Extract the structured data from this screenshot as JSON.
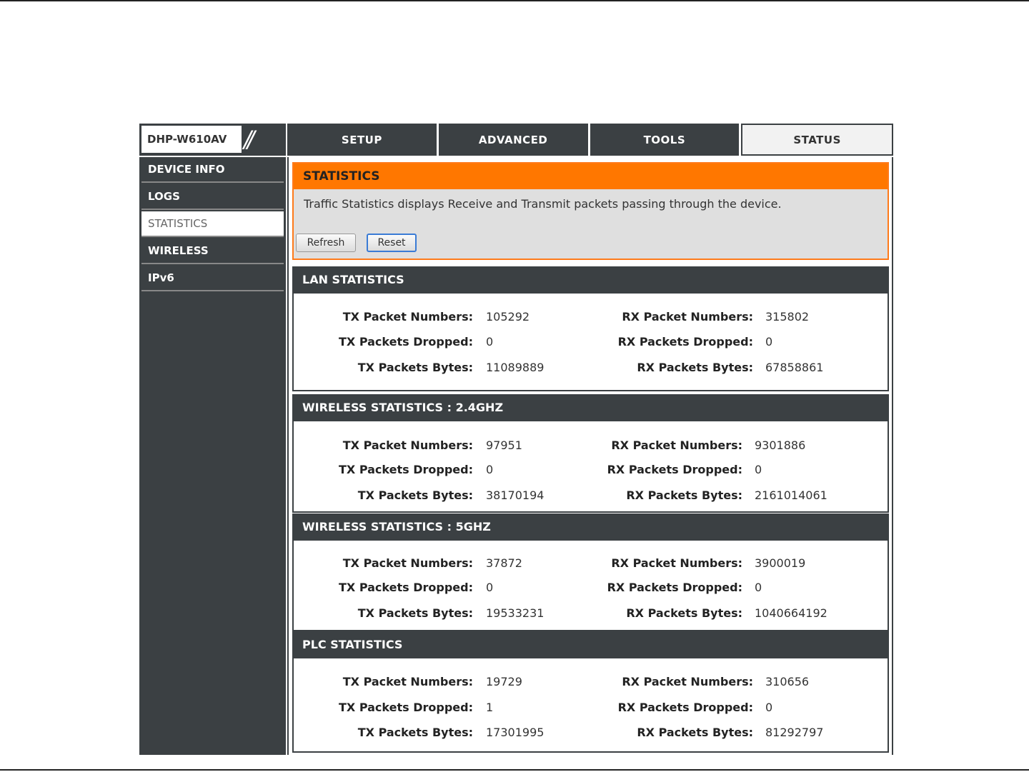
{
  "header": {
    "model": "DHP-W610AV",
    "tabs": [
      {
        "label": "SETUP"
      },
      {
        "label": "ADVANCED"
      },
      {
        "label": "TOOLS"
      },
      {
        "label": "STATUS"
      }
    ]
  },
  "sidebar": {
    "items": [
      {
        "label": "DEVICE INFO"
      },
      {
        "label": "LOGS"
      },
      {
        "label": "STATISTICS"
      },
      {
        "label": "WIRELESS"
      },
      {
        "label": "IPv6"
      }
    ]
  },
  "statistics": {
    "title": "STATISTICS",
    "description": "Traffic Statistics displays Receive and Transmit packets passing through the device.",
    "refresh_label": "Refresh",
    "reset_label": "Reset"
  },
  "labels": {
    "tx_numbers": "TX Packet Numbers:",
    "tx_dropped": "TX Packets Dropped:",
    "tx_bytes": "TX Packets Bytes:",
    "rx_numbers": "RX Packet Numbers:",
    "rx_dropped": "RX Packets Dropped:",
    "rx_bytes": "RX Packets Bytes:"
  },
  "sections": [
    {
      "title": "LAN STATISTICS",
      "tx_numbers": "105292",
      "tx_dropped": "0",
      "tx_bytes": "11089889",
      "rx_numbers": "315802",
      "rx_dropped": "0",
      "rx_bytes": "67858861"
    },
    {
      "title": "WIRELESS STATISTICS : 2.4GHZ",
      "tx_numbers": "97951",
      "tx_dropped": "0",
      "tx_bytes": "38170194",
      "rx_numbers": "9301886",
      "rx_dropped": "0",
      "rx_bytes": "2161014061"
    },
    {
      "title": "WIRELESS STATISTICS : 5GHZ",
      "tx_numbers": "37872",
      "tx_dropped": "0",
      "tx_bytes": "19533231",
      "rx_numbers": "3900019",
      "rx_dropped": "0",
      "rx_bytes": "1040664192"
    },
    {
      "title": "PLC STATISTICS",
      "tx_numbers": "19729",
      "tx_dropped": "1",
      "tx_bytes": "17301995",
      "rx_numbers": "310656",
      "rx_dropped": "0",
      "rx_bytes": "81292797"
    }
  ]
}
